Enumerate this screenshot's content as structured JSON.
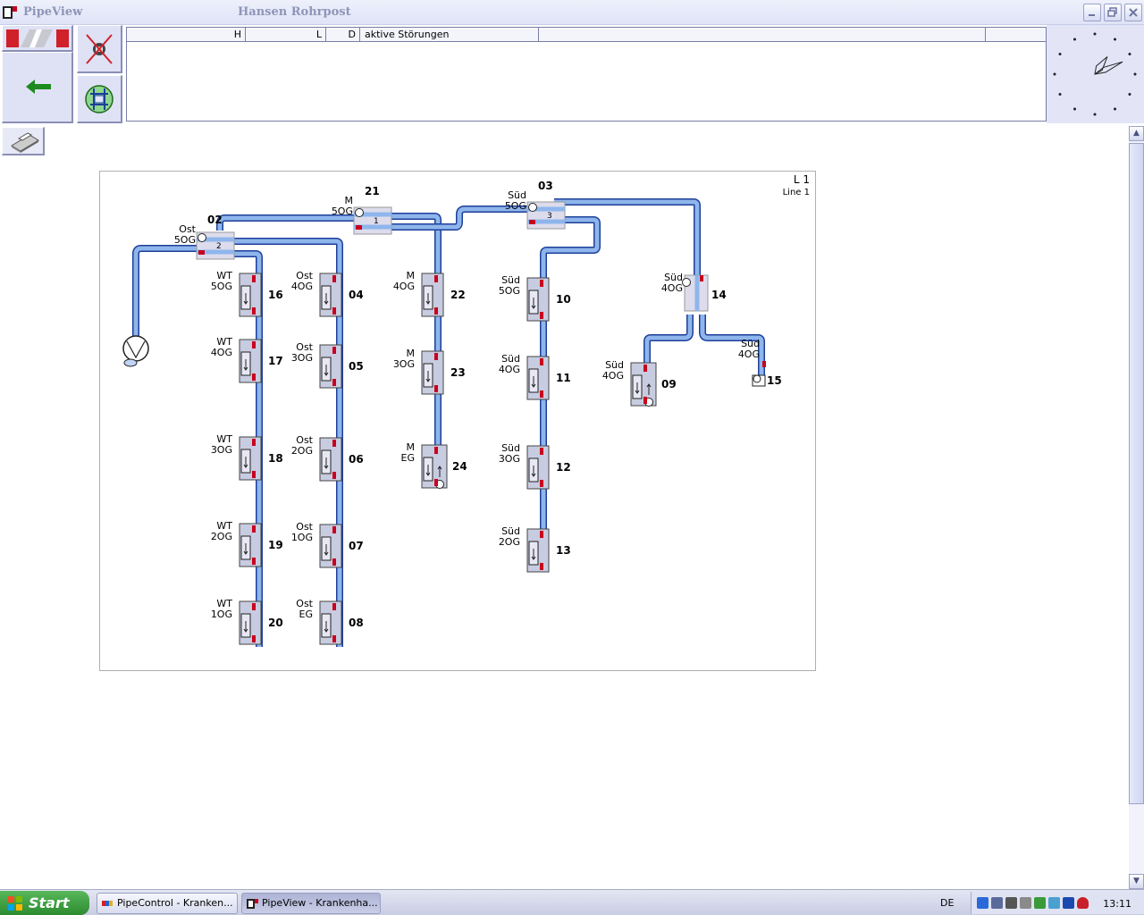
{
  "window": {
    "title": "PipeView",
    "subtitle": "Hansen Rohrpost",
    "minimize_icon": "minimize-icon",
    "maximize_icon": "restore-icon",
    "close_icon": "close-icon"
  },
  "toolbar": {
    "gate_icon": "gate-icon",
    "back_icon": "arrow-left-icon",
    "noalarm_icon": "alarm-off-icon",
    "grid_icon": "network-icon",
    "print_icon": "printer-icon"
  },
  "alarms": {
    "columns": [
      "H",
      "L",
      "D",
      "aktive Störungen",
      "",
      ""
    ]
  },
  "map": {
    "line_name": "L 1",
    "line_label": "Line 1",
    "stations": [
      {
        "id": "16",
        "l1": "WT",
        "l2": "5OG"
      },
      {
        "id": "17",
        "l1": "WT",
        "l2": "4OG"
      },
      {
        "id": "18",
        "l1": "WT",
        "l2": "3OG"
      },
      {
        "id": "19",
        "l1": "WT",
        "l2": "2OG"
      },
      {
        "id": "20",
        "l1": "WT",
        "l2": "1OG"
      },
      {
        "id": "04",
        "l1": "Ost",
        "l2": "4OG"
      },
      {
        "id": "05",
        "l1": "Ost",
        "l2": "3OG"
      },
      {
        "id": "06",
        "l1": "Ost",
        "l2": "2OG"
      },
      {
        "id": "07",
        "l1": "Ost",
        "l2": "1OG"
      },
      {
        "id": "08",
        "l1": "Ost",
        "l2": "EG"
      },
      {
        "id": "22",
        "l1": "M",
        "l2": "4OG"
      },
      {
        "id": "23",
        "l1": "M",
        "l2": "3OG"
      },
      {
        "id": "24",
        "l1": "M",
        "l2": "EG"
      },
      {
        "id": "10",
        "l1": "Süd",
        "l2": "5OG"
      },
      {
        "id": "11",
        "l1": "Süd",
        "l2": "4OG"
      },
      {
        "id": "12",
        "l1": "Süd",
        "l2": "3OG"
      },
      {
        "id": "13",
        "l1": "Süd",
        "l2": "2OG"
      },
      {
        "id": "09",
        "l1": "Süd",
        "l2": "4OG"
      },
      {
        "id": "15",
        "l1": "Süd",
        "l2": "4OG"
      }
    ],
    "diverters": [
      {
        "id": "02",
        "l1": "Ost",
        "l2": "5OG",
        "port": "2"
      },
      {
        "id": "21",
        "l1": "M",
        "l2": "5OG",
        "port": "1"
      },
      {
        "id": "03",
        "l1": "Süd",
        "l2": "5OG",
        "port": "3"
      },
      {
        "id": "14",
        "l1": "Süd",
        "l2": "4OG",
        "port": ""
      }
    ],
    "pipe_color": "#8fb6ec",
    "pipe_edge": "#1e3f9a",
    "alarm_color": "#c8001e"
  },
  "taskbar": {
    "start_label": "Start",
    "tasks": [
      "PipeControl - Kranken...",
      "PipeView - Krankenha..."
    ],
    "language": "DE",
    "time": "13:11"
  }
}
